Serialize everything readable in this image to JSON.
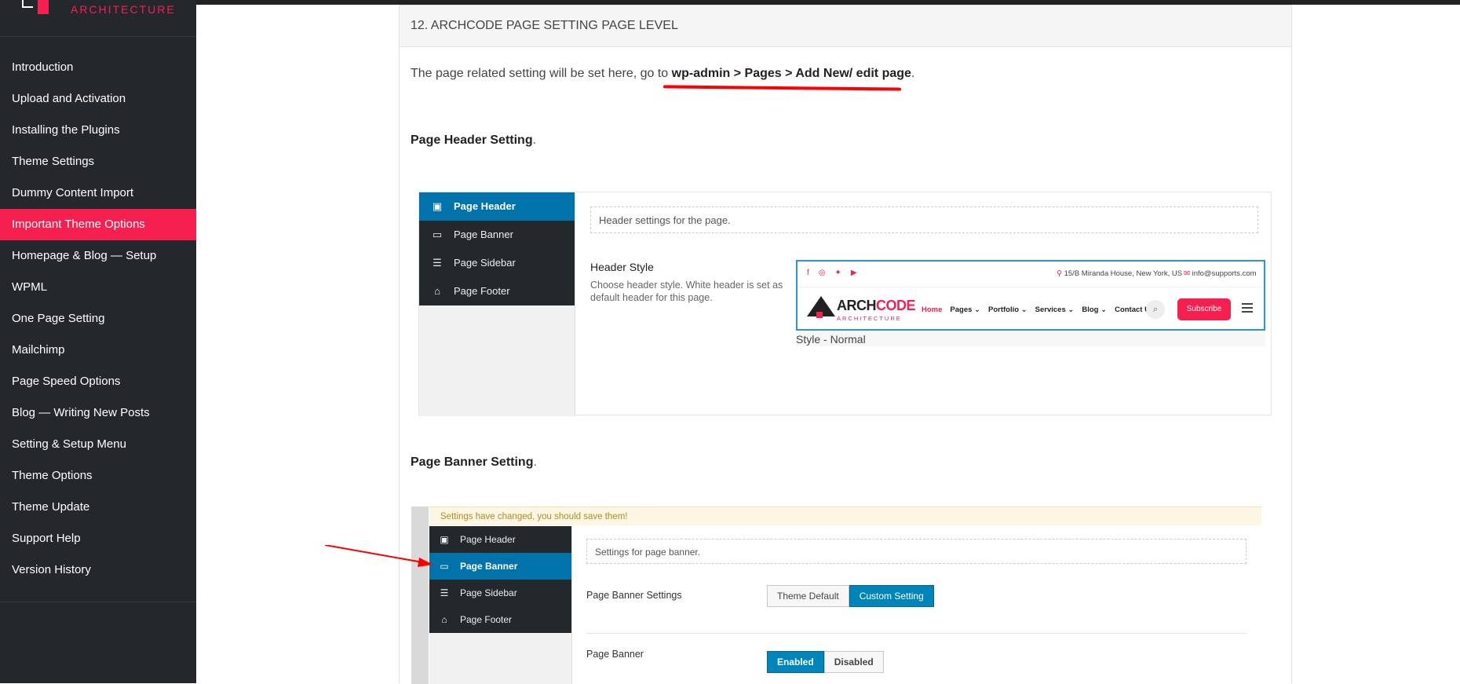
{
  "brand": {
    "text": "ARCHITECTURE"
  },
  "sidebar": {
    "items": [
      {
        "label": "Introduction",
        "active": false
      },
      {
        "label": "Upload and Activation",
        "active": false
      },
      {
        "label": "Installing the Plugins",
        "active": false
      },
      {
        "label": "Theme Settings",
        "active": false
      },
      {
        "label": "Dummy Content Import",
        "active": false
      },
      {
        "label": "Important Theme Options",
        "active": true
      },
      {
        "label": "Homepage & Blog — Setup",
        "active": false
      },
      {
        "label": "WPML",
        "active": false
      },
      {
        "label": "One Page Setting",
        "active": false
      },
      {
        "label": "Mailchimp",
        "active": false
      },
      {
        "label": "Page Speed Options",
        "active": false
      },
      {
        "label": "Blog — Writing New Posts",
        "active": false
      },
      {
        "label": "Setting & Setup Menu",
        "active": false
      },
      {
        "label": "Theme Options",
        "active": false
      },
      {
        "label": "Theme Update",
        "active": false
      },
      {
        "label": "Support Help",
        "active": false
      },
      {
        "label": "Version History",
        "active": false
      }
    ]
  },
  "section": {
    "title": "12. ARCHCODE PAGE SETTING PAGE LEVEL",
    "intro_prefix": "The page related setting will be set here, go to ",
    "intro_path": "wp-admin > Pages > Add New/ edit page",
    "intro_suffix": "."
  },
  "header_setting": {
    "title": "Page Header Setting",
    "dot": ".",
    "menu": [
      {
        "label": "Page Header",
        "icon": "window-icon",
        "selected": true
      },
      {
        "label": "Page Banner",
        "icon": "monitor-icon",
        "selected": false
      },
      {
        "label": "Page Sidebar",
        "icon": "list-icon",
        "selected": false
      },
      {
        "label": "Page Footer",
        "icon": "home-icon",
        "selected": false
      }
    ],
    "field_text": "Header settings for the page.",
    "style_label": "Header Style",
    "style_desc": "Choose header style. White header is set as default header for this page.",
    "preview": {
      "address": "15/B Miranda House, New York, US",
      "email": "info@supports.com",
      "logo_main": "ARCH",
      "logo_accent": "CODE",
      "logo_sub": "ARCHITECTURE",
      "nav": [
        "Home",
        "Pages ⌄",
        "Portfolio ⌄",
        "Services ⌄",
        "Blog ⌄",
        "Contact Us"
      ],
      "subscribe": "Subscribe"
    },
    "caption": "Style - Normal"
  },
  "banner_setting": {
    "title": "Page Banner Setting",
    "dot": ".",
    "notice": "Settings have changed, you should save them!",
    "menu": [
      {
        "label": "Page Header",
        "icon": "window-icon",
        "selected": false
      },
      {
        "label": "Page Banner",
        "icon": "monitor-icon",
        "selected": true
      },
      {
        "label": "Page Sidebar",
        "icon": "list-icon",
        "selected": false
      },
      {
        "label": "Page Footer",
        "icon": "home-icon",
        "selected": false
      }
    ],
    "field_text": "Settings for page banner.",
    "settings_label": "Page Banner Settings",
    "settings_options": [
      "Theme Default",
      "Custom Setting"
    ],
    "banner_label": "Page Banner",
    "banner_options": [
      "Enabled",
      "Disabled"
    ]
  },
  "colors": {
    "accent": "#f5204f",
    "wp_blue": "#0073aa",
    "sidebar_bg": "#24272c"
  }
}
